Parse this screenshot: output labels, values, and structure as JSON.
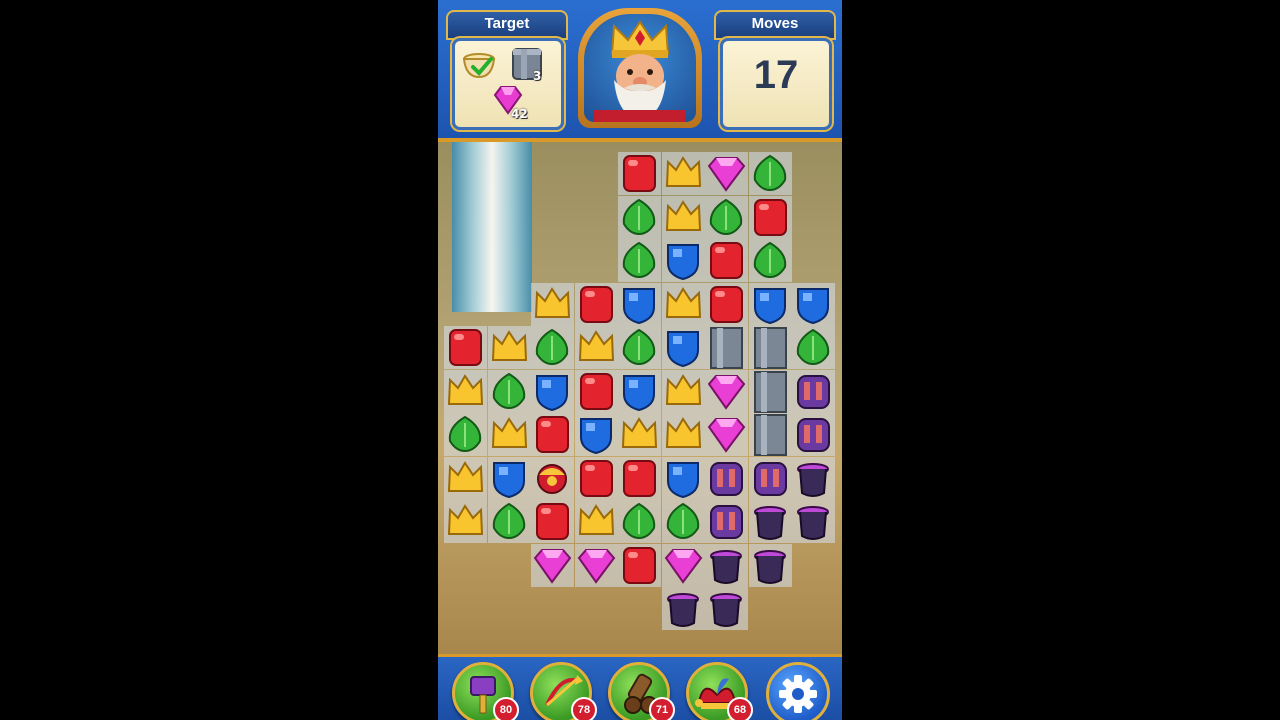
{
  "header": {
    "target_label": "Target",
    "moves_label": "Moves",
    "moves_count": "17",
    "targets": [
      {
        "icon": "teacup-icon",
        "completed": true
      },
      {
        "icon": "pipe-icon",
        "count": "3"
      },
      {
        "icon": "pink-gem-icon",
        "count": "42"
      }
    ]
  },
  "boosters": [
    {
      "icon": "hammer-icon",
      "count": "80"
    },
    {
      "icon": "arrow-icon",
      "count": "78"
    },
    {
      "icon": "cannon-icon",
      "count": "71"
    },
    {
      "icon": "jester-hat-icon",
      "count": "68"
    }
  ],
  "settings": {
    "icon": "gear-icon"
  },
  "colors": {
    "accent": "#e0a232",
    "bar": "#1d54b0"
  },
  "board": {
    "rows": [
      [
        "_",
        "_",
        "_",
        "_",
        "R",
        "C",
        "P",
        "G",
        "_"
      ],
      [
        "_",
        "_",
        "_",
        "_",
        "G",
        "C",
        "G",
        "R",
        "_"
      ],
      [
        "_",
        "_",
        "_",
        "_",
        "G",
        "B",
        "R",
        "G",
        "_"
      ],
      [
        "_",
        "_",
        "C",
        "R",
        "B",
        "C",
        "R",
        "B",
        "B"
      ],
      [
        "R",
        "C",
        "G",
        "C",
        "G",
        "B",
        "X",
        "X",
        "G"
      ],
      [
        "C",
        "G",
        "B",
        "R",
        "B",
        "C",
        "P",
        "X",
        "O"
      ],
      [
        "G",
        "C",
        "R",
        "B",
        "C",
        "C",
        "P",
        "X",
        "O"
      ],
      [
        "C",
        "B",
        "J",
        "R",
        "R",
        "B",
        "O",
        "O",
        "H"
      ],
      [
        "C",
        "G",
        "R",
        "C",
        "G",
        "G",
        "O",
        "H",
        "H"
      ],
      [
        "_",
        "_",
        "P",
        "P",
        "R",
        "P",
        "H",
        "H",
        "_"
      ],
      [
        "_",
        "_",
        "_",
        "_",
        "_",
        "H",
        "H",
        "_",
        "_"
      ]
    ]
  }
}
